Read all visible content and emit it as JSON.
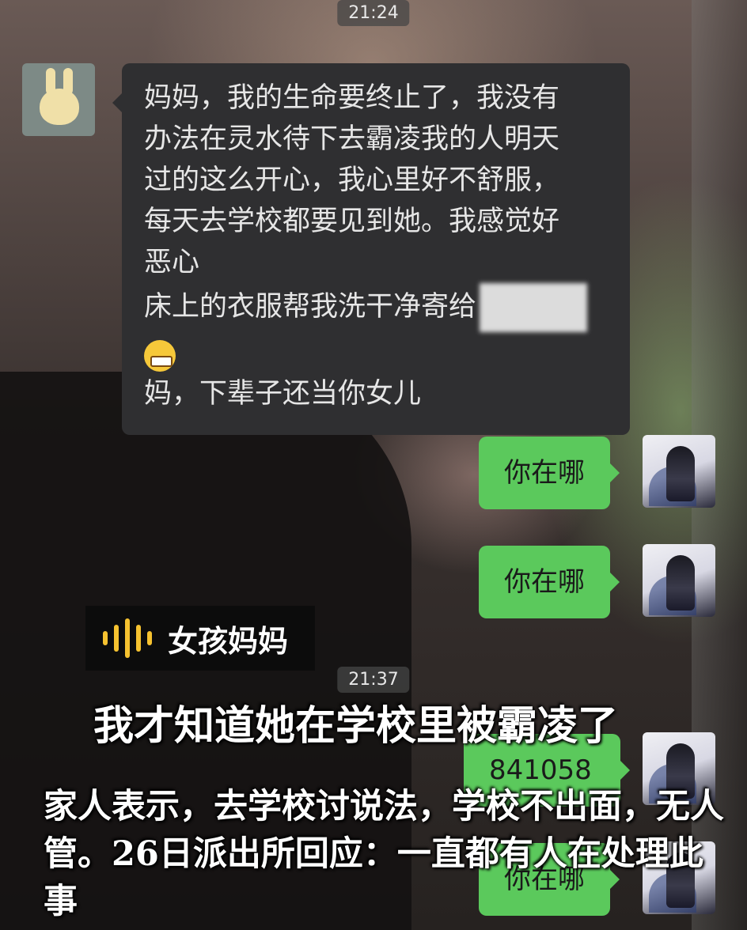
{
  "chat": {
    "timestamp_1": "21:24",
    "incoming_message": {
      "lines": [
        "妈妈，我的生命要终止了，我没有",
        "办法在灵水待下去霸凌我的人明天",
        "过的这么开心，我心里好不舒服，",
        "每天去学校都要见到她。我感觉好",
        "恶心",
        "床上的衣服帮我洗干净寄给",
        "妈，下辈子还当你女儿"
      ],
      "emoji": "grinning-face-icon"
    },
    "outgoing_messages": [
      "你在哪",
      "你在哪",
      "841058",
      "你在哪"
    ],
    "timestamp_2": "21:37"
  },
  "overlay": {
    "speaker_label": "女孩妈妈",
    "caption_main": "我才知道她在学校里被霸凌了",
    "caption_body": "家人表示，去学校讨说法，学校不出面，无人管。26日派出所回应：一直都有人在处理此事"
  },
  "colors": {
    "incoming_bubble": "#2f2f31",
    "outgoing_bubble": "#5bc95c",
    "waveform": "#f6c230"
  }
}
